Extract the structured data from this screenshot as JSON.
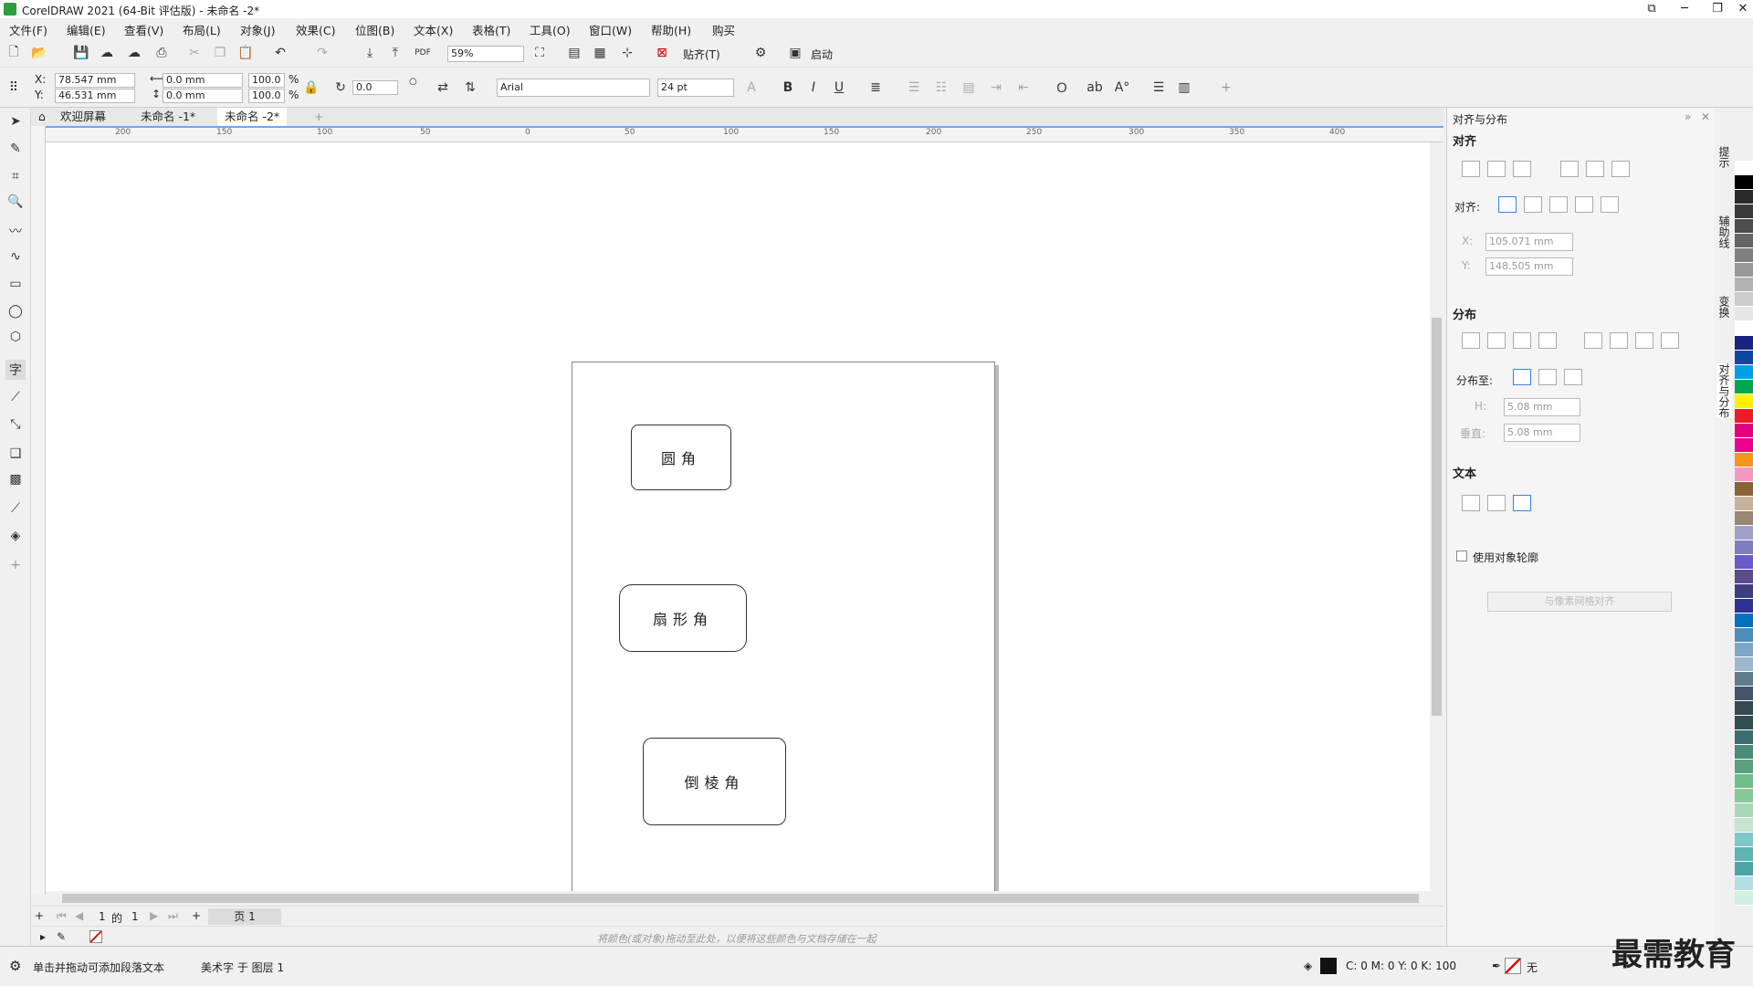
{
  "window": {
    "title": "CorelDRAW 2021 (64-Bit 评估版) - 未命名 -2*"
  },
  "menu": [
    "文件(F)",
    "编辑(E)",
    "查看(V)",
    "布局(L)",
    "对象(J)",
    "效果(C)",
    "位图(B)",
    "文本(X)",
    "表格(T)",
    "工具(O)",
    "窗口(W)",
    "帮助(H)",
    "购买"
  ],
  "toolbar": {
    "zoom": "59%",
    "snap": "贴齐(T)",
    "launch": "启动"
  },
  "props": {
    "x_label": "X:",
    "y_label": "Y:",
    "x": "78.547 mm",
    "y": "46.531 mm",
    "w": "0.0 mm",
    "h": "0.0 mm",
    "sx": "100.0",
    "sy": "100.0",
    "pct": "%",
    "rot": "0.0",
    "font": "Arial",
    "size": "24 pt"
  },
  "tabs": [
    "欢迎屏幕",
    "未命名 -1*",
    "未命名 -2*"
  ],
  "ruler_h": [
    "200",
    "150",
    "100",
    "50",
    "0",
    "50",
    "100",
    "150",
    "200",
    "250",
    "300",
    "350",
    "400"
  ],
  "shapes": [
    {
      "label": "圆角"
    },
    {
      "label": "扇形角"
    },
    {
      "label": "倒棱角"
    }
  ],
  "pagenav": {
    "cur": "1",
    "of": "的",
    "total": "1",
    "page": "页 1"
  },
  "colorhint": "将颜色(或对象)拖动至此处，以便将这些颜色与文档存储在一起",
  "status": {
    "hint": "单击并拖动可添加段落文本",
    "layer": "美术字 于 图层 1",
    "cmyk": "C: 0 M: 0 Y: 0 K: 100",
    "none": "无"
  },
  "docker": {
    "title": "对齐与分布",
    "align": "对齐",
    "align_to": "对齐:",
    "x": "105.071 mm",
    "y": "148.505 mm",
    "x_label": "X:",
    "y_label": "Y:",
    "distribute": "分布",
    "distribute_to": "分布至:",
    "h_label": "H:",
    "v_label": "垂直:",
    "h": "5.08 mm",
    "v": "5.08 mm",
    "text": "文本",
    "use_outline": "使用对象轮廓",
    "grid_btn": "与像素网格对齐"
  },
  "sidetabs": [
    "提示",
    "辅助线",
    "变换",
    "对齐与分布"
  ],
  "palette": [
    "#ffffff",
    "#000000",
    "#2b2b2b",
    "#3a3a3a",
    "#4d4d4d",
    "#666666",
    "#808080",
    "#999999",
    "#b3b3b3",
    "#cccccc",
    "#e6e6e6",
    "#ffffff",
    "#1a237e",
    "#0d47a1",
    "#00a0e9",
    "#00a650",
    "#fff200",
    "#ed1c24",
    "#e4007f",
    "#ec008c",
    "#f7941d",
    "#f49ac1",
    "#8c6239",
    "#c7b299",
    "#998675",
    "#a3a0c8",
    "#7f7fbf",
    "#6a5acd",
    "#5b4b8a",
    "#3f3f7f",
    "#2e3192",
    "#0072bc",
    "#4c8fbd",
    "#7fa7c9",
    "#9db7cf",
    "#5f7c8a",
    "#44546a",
    "#37474f",
    "#2f4f4f",
    "#3c6e71",
    "#4a8c7a",
    "#5aa17f",
    "#6dbf8c",
    "#88c999",
    "#a8d8b9",
    "#c5e3cf",
    "#7ec8c8",
    "#5fb3b3",
    "#4da6a6",
    "#b0e0e6",
    "#d0f0e0"
  ],
  "watermark": "最需教育"
}
